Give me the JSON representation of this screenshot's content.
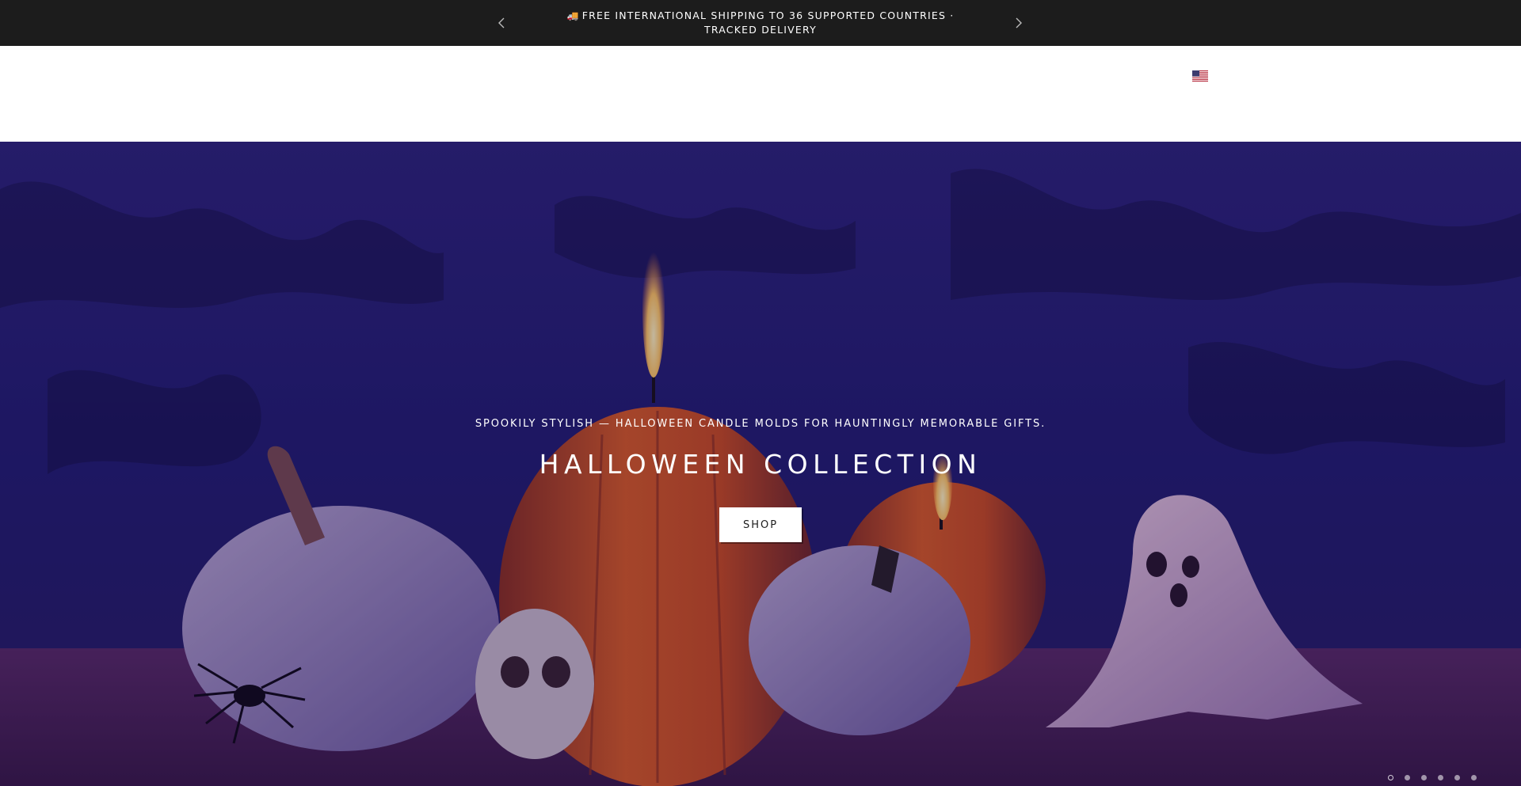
{
  "announcement": {
    "truck_icon": "truck-icon",
    "text_line1": "FREE INTERNATIONAL SHIPPING TO 36 SUPPORTED COUNTRIES ·",
    "text_line2": "TRACKED DELIVERY",
    "prev_icon": "chevron-left-icon",
    "next_icon": "chevron-right-icon"
  },
  "header": {
    "locale_flag": "us-flag-icon"
  },
  "hero": {
    "subtitle": "SPOOKILY STYLISH — HALLOWEEN CANDLE MOLDS FOR HAUNTINGLY MEMORABLE GIFTS.",
    "title": "HALLOWEEN COLLECTION",
    "button_label": "SHOP",
    "slide_count": 6,
    "active_slide": 1
  },
  "colors": {
    "announcement_bg": "#1c1c1c",
    "hero_backdrop": "#2a1f8a",
    "hero_floor": "#4a1f5c",
    "pumpkin_orange": "#d2542a",
    "button_bg": "#ffffff"
  }
}
